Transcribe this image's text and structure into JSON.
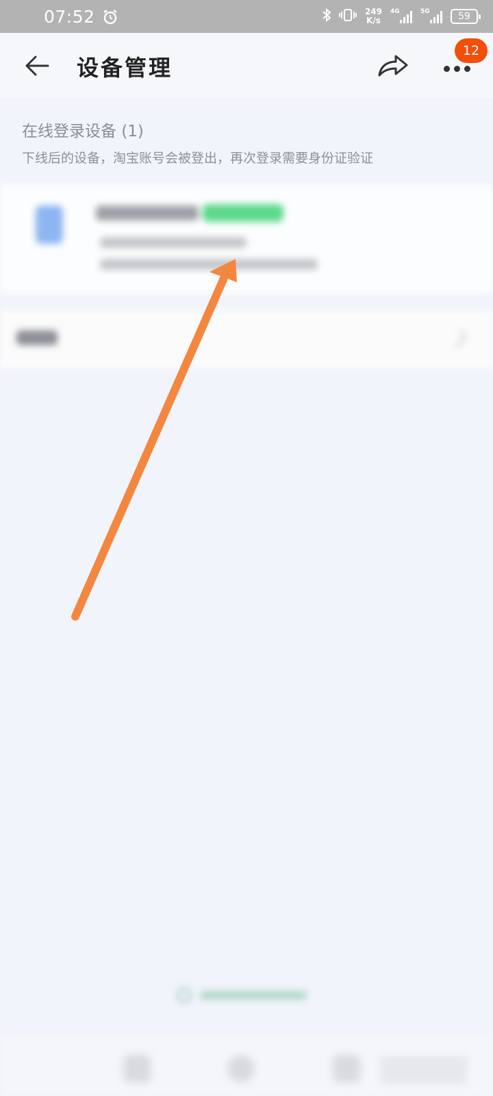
{
  "status_bar": {
    "time": "07:52",
    "net_speed_value": "249",
    "net_speed_unit": "K/s",
    "sim1_tag": "4G",
    "sim2_tag": "5G",
    "battery": "59"
  },
  "header": {
    "title": "设备管理",
    "notification_count": "12"
  },
  "section": {
    "title": "在线登录设备 (1)",
    "subtitle": "下线后的设备，淘宝账号会被登出，再次登录需要身份证验证"
  },
  "colors": {
    "annotation_arrow": "#f4873f",
    "badge": "#f24e0c",
    "status_bar": "#b3b3b3"
  }
}
